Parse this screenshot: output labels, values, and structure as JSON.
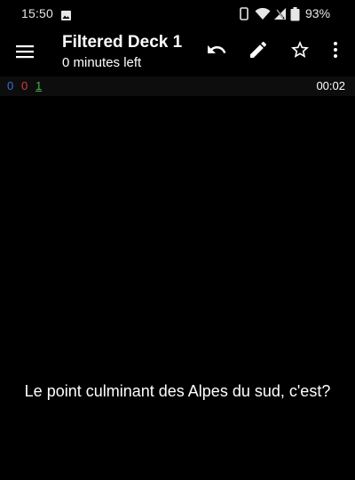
{
  "status_bar": {
    "time": "15:50",
    "battery_percent": "93%"
  },
  "icons": {
    "status": [
      "gallery-icon",
      "phone-icon",
      "wifi-icon",
      "signal-icon",
      "battery-icon"
    ],
    "toolbar": [
      "menu-icon",
      "undo-icon",
      "edit-icon",
      "star-icon",
      "more-vert-icon"
    ]
  },
  "toolbar": {
    "title": "Filtered Deck 1",
    "subtitle": "0 minutes left"
  },
  "counts": {
    "new": "0",
    "learning": "0",
    "review": "1",
    "timer": "00:02"
  },
  "colors": {
    "background": "#000000",
    "new_count": "#3b6fd8",
    "learning_count": "#d23c3c",
    "review_count": "#4caf50"
  },
  "card": {
    "question": "Le point culminant des Alpes du sud, c'est?"
  }
}
